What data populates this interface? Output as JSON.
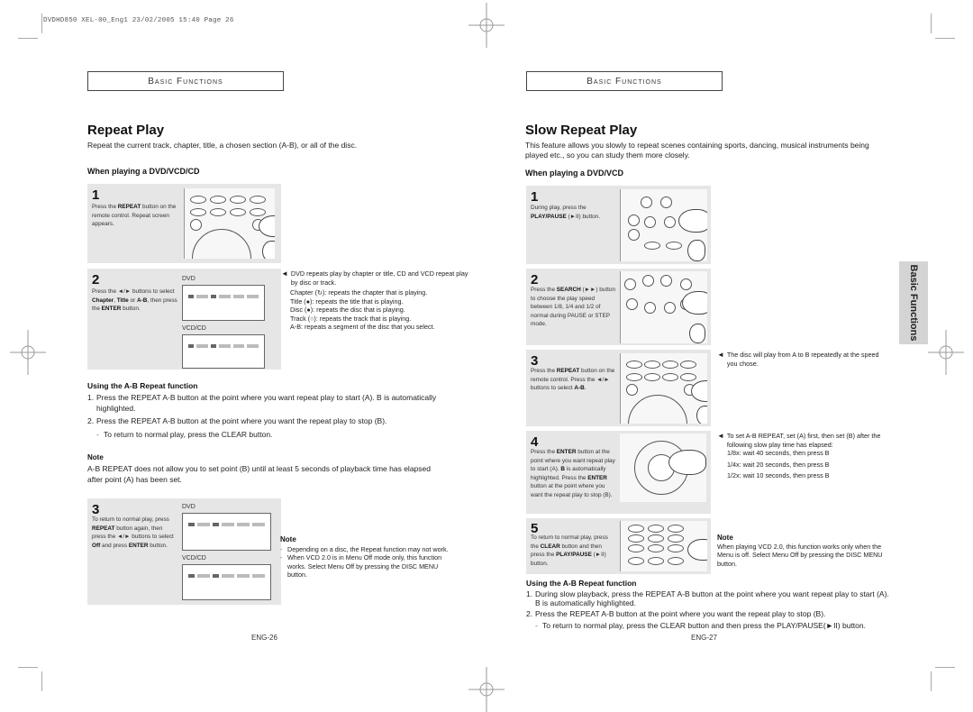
{
  "print_slug": "DVDHD850 XEL-00_Eng1   23/02/2005   15:40   Page 26",
  "left_page": {
    "section_header": "Basic Functions",
    "title": "Repeat Play",
    "intro": "Repeat the current track, chapter, title, a chosen section (A-B), or all of the disc.",
    "subhead": "When playing a DVD/VCD/CD",
    "steps": [
      {
        "num": "1",
        "text_html": "Press the <b>REPEAT</b> button on the remote control. Repeat screen appears.",
        "illustration": "remote-control-repeat-button"
      },
      {
        "num": "2",
        "text_html": "Press the ◄/► buttons to select <b>Chapter</b>, <b>Title</b> or <b>A-B</b>, then press the <b>ENTER</b> button.",
        "screens": [
          "DVD",
          "VCD/CD"
        ]
      },
      {
        "num": "3",
        "text_html": "To return to normal play, press <b>REPEAT</b> button again, then press the ◄/► buttons to select <b>Off</b> and press <b>ENTER</b> button.",
        "screens": [
          "DVD",
          "VCD/CD"
        ]
      }
    ],
    "step2_notes": {
      "lead": "DVD repeats play by chapter or title, CD and VCD repeat play by disc or track.",
      "items": [
        "Chapter (↻): repeats the chapter that is playing.",
        "Title (●): repeats the title that is playing.",
        "Disc (●): repeats the disc that is playing.",
        "Track (○): repeats the track that is playing.",
        "A-B: repeats a segment of the disc that you select."
      ]
    },
    "ab_repeat": {
      "heading": "Using the A-B Repeat function",
      "items": [
        {
          "n": "1.",
          "text": "Press the REPEAT A-B button at the point where you want repeat play to start (A). B is automatically highlighted."
        },
        {
          "n": "2.",
          "text": "Press the REPEAT A-B button at the point where you want the repeat play to stop (B)."
        }
      ],
      "sub": "To return to normal play, press the CLEAR button."
    },
    "note": {
      "title": "Note",
      "text": "A-B REPEAT does not allow you to set point (B) until at least 5 seconds of playback time has elapsed after point (A) has been set."
    },
    "note2": {
      "title": "Note",
      "items": [
        "Depending on a disc, the Repeat function may not work.",
        "When VCD 2.0 is in Menu Off mode only, this function works. Select Menu Off by pressing the DISC MENU button."
      ]
    },
    "page_number": "ENG-26"
  },
  "right_page": {
    "section_header": "Basic Functions",
    "title": "Slow Repeat Play",
    "intro": "This feature allows you slowly to repeat scenes containing sports, dancing, musical instruments being played etc., so you can study them more closely.",
    "subhead": "When playing a DVD/VCD",
    "steps": [
      {
        "num": "1",
        "text_html": "During play, press the <b>PLAY/PAUSE</b> (►II) button.",
        "illustration": "remote-play-pause-button"
      },
      {
        "num": "2",
        "text_html": "Press the <b>SEARCH</b> (►►) button to choose the play speed between 1/8, 1/4 and 1/2 of normal during PAUSE or STEP mode.",
        "illustration": "remote-search-button"
      },
      {
        "num": "3",
        "text_html": "Press the <b>REPEAT</b> button on the remote control. Press the ◄/► buttons to select <b>A-B</b>.",
        "illustration": "remote-repeat-button"
      },
      {
        "num": "4",
        "text_html": "Press the <b>ENTER</b> button at the point where you want repeat play to start (A). <b>B</b> is automatically highlighted. Press the <b>ENTER</b> button at the point where you want the repeat play to stop (B).",
        "illustration": "remote-enter-button"
      },
      {
        "num": "5",
        "text_html": "To return to normal play, press the <b>CLEAR</b> button and then press the <b>PLAY/PAUSE</b> (►II) button.",
        "illustration": "remote-clear-button"
      }
    ],
    "step3_note": "The disc will play from A to B repeatedly at the speed you chose.",
    "step4_note": {
      "lead": "To set A-B REPEAT, set (A) first, then set (B) after the following slow play time has elapsed:",
      "items": [
        "1/8x: wait 40 seconds, then press B",
        "1/4x: wait 20 seconds, then press B",
        "1/2x: wait 10 seconds, then press B"
      ]
    },
    "note": {
      "title": "Note",
      "text": "When playing VCD 2.0, this function works only when the Menu is off. Select Menu Off by pressing the DISC MENU button."
    },
    "ab_repeat": {
      "heading": "Using the A-B Repeat function",
      "items": [
        {
          "n": "1.",
          "text": "During slow playback, press the REPEAT A-B button at the point where you want repeat play to start (A). B is automatically highlighted."
        },
        {
          "n": "2.",
          "text": "Press the REPEAT A-B button at the point where you want the repeat play to stop (B)."
        }
      ],
      "sub": "To return to normal play, press the CLEAR button and then press the PLAY/PAUSE(►II) button."
    },
    "side_tab": "Basic Functions",
    "page_number": "ENG-27"
  }
}
